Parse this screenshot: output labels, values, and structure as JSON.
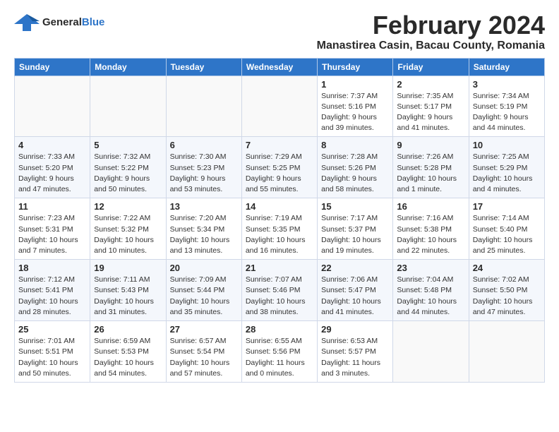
{
  "logo": {
    "line1": "General",
    "line2": "Blue"
  },
  "title": {
    "month": "February 2024",
    "location": "Manastirea Casin, Bacau County, Romania"
  },
  "headers": [
    "Sunday",
    "Monday",
    "Tuesday",
    "Wednesday",
    "Thursday",
    "Friday",
    "Saturday"
  ],
  "weeks": [
    [
      {
        "day": "",
        "info": ""
      },
      {
        "day": "",
        "info": ""
      },
      {
        "day": "",
        "info": ""
      },
      {
        "day": "",
        "info": ""
      },
      {
        "day": "1",
        "info": "Sunrise: 7:37 AM\nSunset: 5:16 PM\nDaylight: 9 hours\nand 39 minutes."
      },
      {
        "day": "2",
        "info": "Sunrise: 7:35 AM\nSunset: 5:17 PM\nDaylight: 9 hours\nand 41 minutes."
      },
      {
        "day": "3",
        "info": "Sunrise: 7:34 AM\nSunset: 5:19 PM\nDaylight: 9 hours\nand 44 minutes."
      }
    ],
    [
      {
        "day": "4",
        "info": "Sunrise: 7:33 AM\nSunset: 5:20 PM\nDaylight: 9 hours\nand 47 minutes."
      },
      {
        "day": "5",
        "info": "Sunrise: 7:32 AM\nSunset: 5:22 PM\nDaylight: 9 hours\nand 50 minutes."
      },
      {
        "day": "6",
        "info": "Sunrise: 7:30 AM\nSunset: 5:23 PM\nDaylight: 9 hours\nand 53 minutes."
      },
      {
        "day": "7",
        "info": "Sunrise: 7:29 AM\nSunset: 5:25 PM\nDaylight: 9 hours\nand 55 minutes."
      },
      {
        "day": "8",
        "info": "Sunrise: 7:28 AM\nSunset: 5:26 PM\nDaylight: 9 hours\nand 58 minutes."
      },
      {
        "day": "9",
        "info": "Sunrise: 7:26 AM\nSunset: 5:28 PM\nDaylight: 10 hours\nand 1 minute."
      },
      {
        "day": "10",
        "info": "Sunrise: 7:25 AM\nSunset: 5:29 PM\nDaylight: 10 hours\nand 4 minutes."
      }
    ],
    [
      {
        "day": "11",
        "info": "Sunrise: 7:23 AM\nSunset: 5:31 PM\nDaylight: 10 hours\nand 7 minutes."
      },
      {
        "day": "12",
        "info": "Sunrise: 7:22 AM\nSunset: 5:32 PM\nDaylight: 10 hours\nand 10 minutes."
      },
      {
        "day": "13",
        "info": "Sunrise: 7:20 AM\nSunset: 5:34 PM\nDaylight: 10 hours\nand 13 minutes."
      },
      {
        "day": "14",
        "info": "Sunrise: 7:19 AM\nSunset: 5:35 PM\nDaylight: 10 hours\nand 16 minutes."
      },
      {
        "day": "15",
        "info": "Sunrise: 7:17 AM\nSunset: 5:37 PM\nDaylight: 10 hours\nand 19 minutes."
      },
      {
        "day": "16",
        "info": "Sunrise: 7:16 AM\nSunset: 5:38 PM\nDaylight: 10 hours\nand 22 minutes."
      },
      {
        "day": "17",
        "info": "Sunrise: 7:14 AM\nSunset: 5:40 PM\nDaylight: 10 hours\nand 25 minutes."
      }
    ],
    [
      {
        "day": "18",
        "info": "Sunrise: 7:12 AM\nSunset: 5:41 PM\nDaylight: 10 hours\nand 28 minutes."
      },
      {
        "day": "19",
        "info": "Sunrise: 7:11 AM\nSunset: 5:43 PM\nDaylight: 10 hours\nand 31 minutes."
      },
      {
        "day": "20",
        "info": "Sunrise: 7:09 AM\nSunset: 5:44 PM\nDaylight: 10 hours\nand 35 minutes."
      },
      {
        "day": "21",
        "info": "Sunrise: 7:07 AM\nSunset: 5:46 PM\nDaylight: 10 hours\nand 38 minutes."
      },
      {
        "day": "22",
        "info": "Sunrise: 7:06 AM\nSunset: 5:47 PM\nDaylight: 10 hours\nand 41 minutes."
      },
      {
        "day": "23",
        "info": "Sunrise: 7:04 AM\nSunset: 5:48 PM\nDaylight: 10 hours\nand 44 minutes."
      },
      {
        "day": "24",
        "info": "Sunrise: 7:02 AM\nSunset: 5:50 PM\nDaylight: 10 hours\nand 47 minutes."
      }
    ],
    [
      {
        "day": "25",
        "info": "Sunrise: 7:01 AM\nSunset: 5:51 PM\nDaylight: 10 hours\nand 50 minutes."
      },
      {
        "day": "26",
        "info": "Sunrise: 6:59 AM\nSunset: 5:53 PM\nDaylight: 10 hours\nand 54 minutes."
      },
      {
        "day": "27",
        "info": "Sunrise: 6:57 AM\nSunset: 5:54 PM\nDaylight: 10 hours\nand 57 minutes."
      },
      {
        "day": "28",
        "info": "Sunrise: 6:55 AM\nSunset: 5:56 PM\nDaylight: 11 hours\nand 0 minutes."
      },
      {
        "day": "29",
        "info": "Sunrise: 6:53 AM\nSunset: 5:57 PM\nDaylight: 11 hours\nand 3 minutes."
      },
      {
        "day": "",
        "info": ""
      },
      {
        "day": "",
        "info": ""
      }
    ]
  ]
}
